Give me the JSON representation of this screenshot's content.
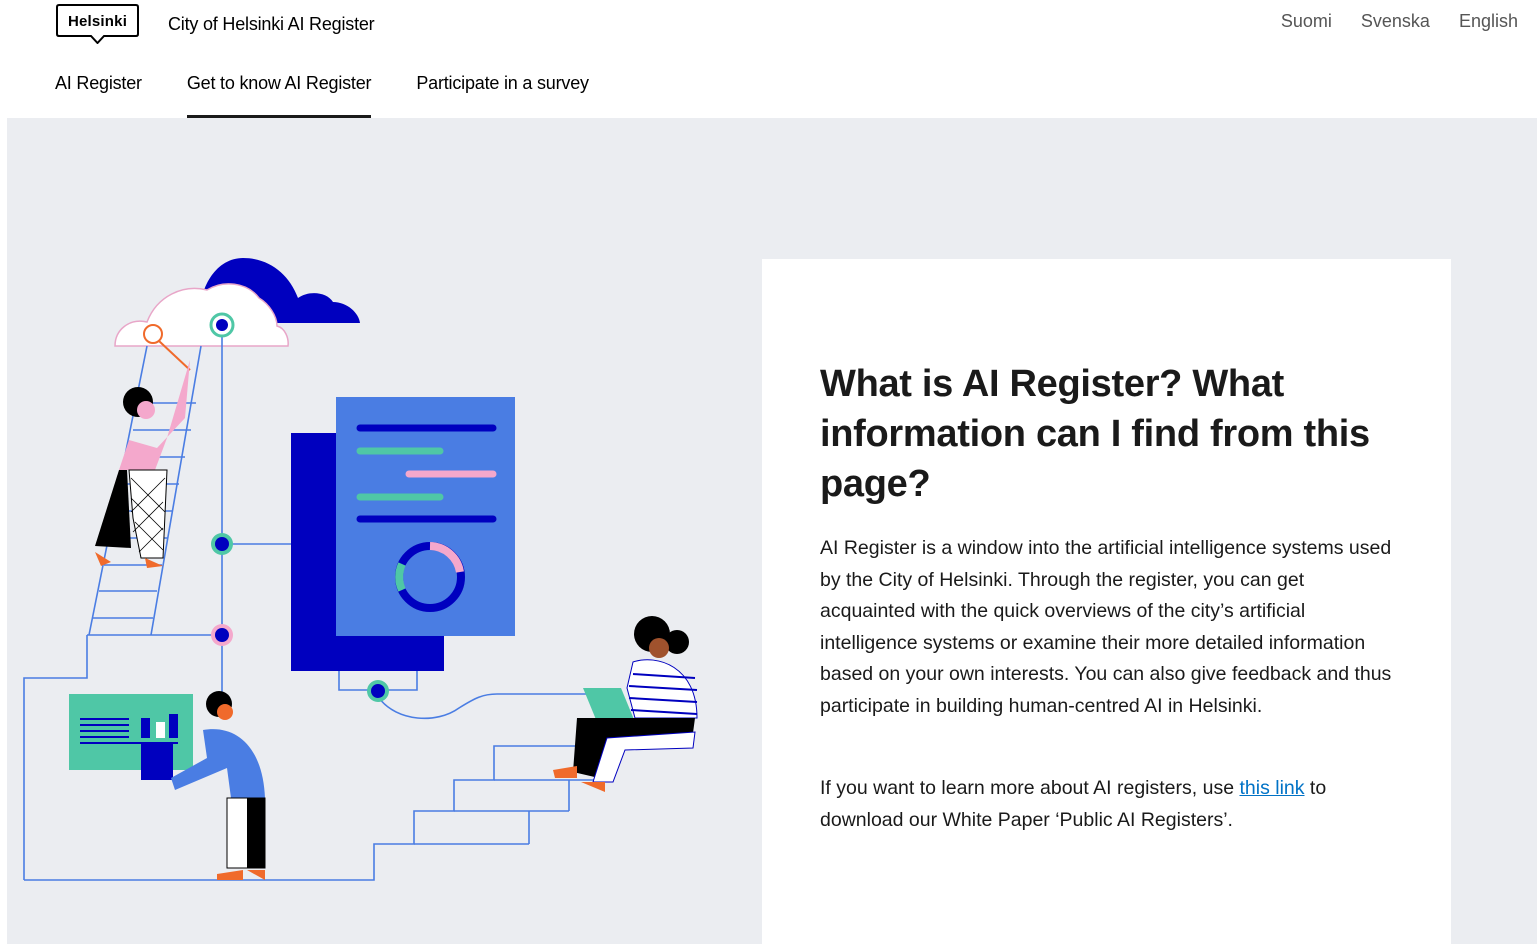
{
  "header": {
    "logo_text": "Helsinki",
    "site_title": "City of Helsinki AI Register",
    "languages": [
      "Suomi",
      "Svenska",
      "English"
    ]
  },
  "nav": {
    "items": [
      {
        "label": "AI Register",
        "active": false
      },
      {
        "label": "Get to know AI Register",
        "active": true
      },
      {
        "label": "Participate in a survey",
        "active": false
      }
    ]
  },
  "content": {
    "heading": "What is AI Register? What information can I find from this page?",
    "body": "AI Register is a window into the artificial intelligence systems used by the City of Helsinki. Through the register, you can get acquainted with the quick overviews of the city’s artificial intelligence systems or examine their more detailed information based on your own interests. You can also give feedback and thus participate in building human-centred AI in Helsinki.",
    "link_before": "If you want to learn more about AI registers, use ",
    "link_label": "this link",
    "link_after": " to download our White Paper ‘Public AI Registers’."
  },
  "colors": {
    "nav_active_underline": "#1a1a1a",
    "hero_background": "#ebedf1",
    "link": "#0072c6",
    "illustration_dark_blue": "#0000bf",
    "illustration_mid_blue": "#4a7de3",
    "illustration_green": "#4fc7a6",
    "illustration_pink": "#f4a8cc",
    "illustration_orange": "#f06a2b"
  }
}
